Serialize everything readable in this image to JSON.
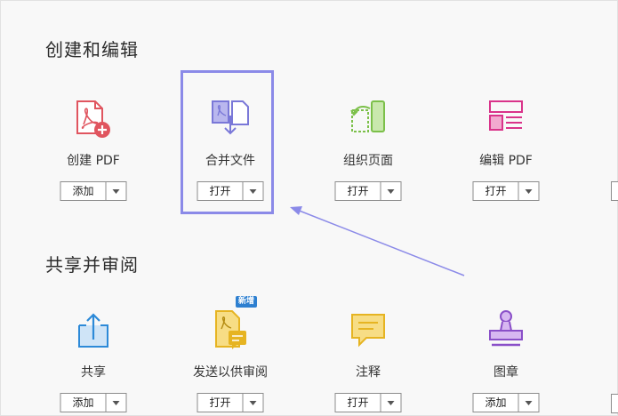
{
  "sections": [
    {
      "title": "创建和编辑",
      "tools": [
        {
          "label": "创建 PDF",
          "button": "添加"
        },
        {
          "label": "合并文件",
          "button": "打开"
        },
        {
          "label": "组织页面",
          "button": "打开"
        },
        {
          "label": "编辑 PDF",
          "button": "打开"
        }
      ]
    },
    {
      "title": "共享并审阅",
      "tools": [
        {
          "label": "共享",
          "button": "添加"
        },
        {
          "label": "发送以供审阅",
          "button": "打开",
          "badge": "新增"
        },
        {
          "label": "注释",
          "button": "打开"
        },
        {
          "label": "图章",
          "button": "添加"
        }
      ]
    }
  ],
  "colors": {
    "highlight": "#8b8ae8",
    "create_pdf": "#e0555f",
    "combine": "#7a78d8",
    "organize": "#7cc04a",
    "edit_pdf": "#d9338a",
    "share": "#2d8ad8",
    "send_review": "#e6b422",
    "comment": "#e6b422",
    "stamp": "#8a4fc8"
  }
}
